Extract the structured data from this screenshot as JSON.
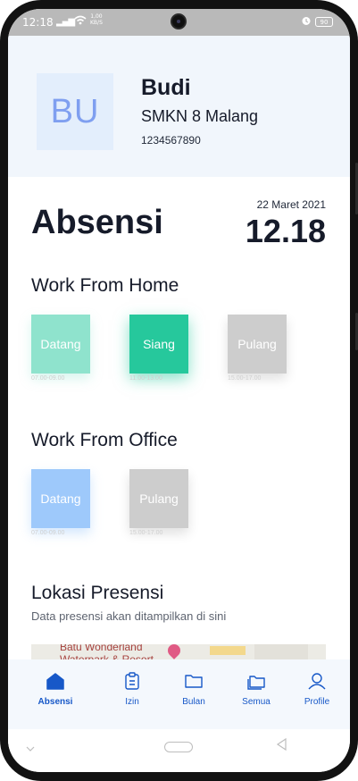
{
  "status_bar": {
    "time": "12:18",
    "signal": "▂▄▆",
    "speed_top": "1,00",
    "speed_bottom": "KB/S",
    "battery": "90"
  },
  "profile": {
    "initials": "BU",
    "name": "Budi",
    "school": "SMKN 8 Malang",
    "id_number": "1234567890"
  },
  "main": {
    "title": "Absensi",
    "date": "22 Maret 2021",
    "time": "12.18"
  },
  "wfh": {
    "title": "Work From Home",
    "tiles": [
      {
        "label": "Datang",
        "range": "07.00-09.00",
        "color": "#8fe3cd"
      },
      {
        "label": "Siang",
        "range": "11.00-13.00",
        "color": "#26c89c"
      },
      {
        "label": "Pulang",
        "range": "15.00-17.00",
        "color": "#cdcdcd"
      }
    ]
  },
  "wfo": {
    "title": "Work From Office",
    "tiles": [
      {
        "label": "Datang",
        "range": "07.00-09.00",
        "color": "#9ec9fb"
      },
      {
        "label": "Pulang",
        "range": "15.00-17.00",
        "color": "#cdcdcd"
      }
    ]
  },
  "location": {
    "title": "Lokasi Presensi",
    "subtitle": "Data presensi akan ditampilkan di sini",
    "map_place_line1": "Batu Wonderland",
    "map_place_line2": "Waterpark & Resort"
  },
  "nav": {
    "items": [
      {
        "label": "Absensi",
        "icon": "home-icon"
      },
      {
        "label": "Izin",
        "icon": "clipboard-icon"
      },
      {
        "label": "Bulan",
        "icon": "folder-icon"
      },
      {
        "label": "Semua",
        "icon": "folders-icon"
      },
      {
        "label": "Profile",
        "icon": "user-icon"
      }
    ]
  },
  "colors": {
    "accent": "#1758c8",
    "header_bg": "#f1f6fc",
    "nav_bg": "#f4f8fd"
  }
}
